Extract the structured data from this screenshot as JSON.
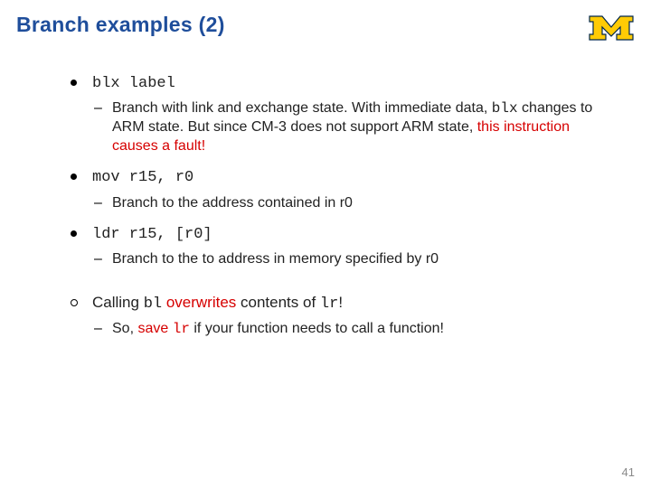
{
  "title": "Branch examples (2)",
  "logo": "M",
  "b1": {
    "code": "blx label",
    "desc_pre": "Branch with link and exchange state.  With immediate data, ",
    "desc_code": "blx",
    "desc_mid": " changes to ARM state.  But since CM-3 does not support ARM state, ",
    "desc_red": "this instruction causes a fault!"
  },
  "b2": {
    "code": "mov r15, r0",
    "desc": "Branch to the address contained in r0"
  },
  "b3": {
    "code": "ldr r15, [r0]",
    "desc": "Branch to the to address in memory specified by r0"
  },
  "b4": {
    "pre": "Calling ",
    "code1": "bl",
    "mid": " overwrites",
    "mid2": " contents of ",
    "code2": "lr",
    "post": "!",
    "sub_pre": "So, ",
    "sub_red": "save ",
    "sub_code": "lr",
    "sub_post": " if your function needs to call a function!"
  },
  "page_number": "41"
}
